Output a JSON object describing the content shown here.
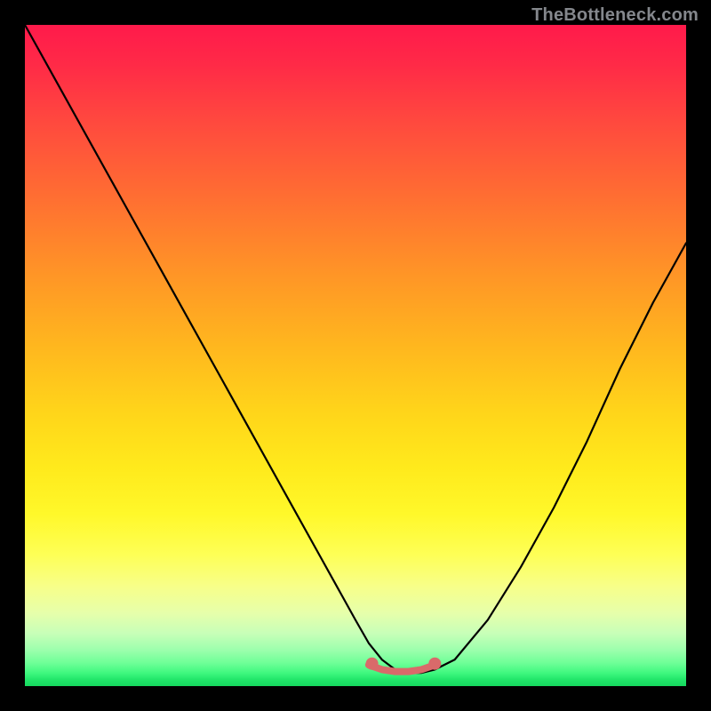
{
  "watermark": "TheBottleneck.com",
  "chart_data": {
    "type": "line",
    "title": "",
    "xlabel": "",
    "ylabel": "",
    "xlim": [
      0,
      100
    ],
    "ylim": [
      0,
      100
    ],
    "grid": false,
    "series": [
      {
        "name": "curve",
        "color": "#000000",
        "x": [
          0,
          5,
          10,
          15,
          20,
          25,
          30,
          35,
          40,
          45,
          50,
          52,
          54,
          56,
          58,
          60,
          62,
          65,
          70,
          75,
          80,
          85,
          90,
          95,
          100
        ],
        "y": [
          100,
          91,
          82,
          73,
          64,
          55,
          46,
          37,
          28,
          19,
          10,
          6.5,
          4,
          2.5,
          2,
          2,
          2.5,
          4,
          10,
          18,
          27,
          37,
          48,
          58,
          67
        ]
      },
      {
        "name": "bottom-segment",
        "color": "#d96a6a",
        "x": [
          52,
          54,
          56,
          58,
          60,
          62
        ],
        "y": [
          3.2,
          2.5,
          2.2,
          2.2,
          2.5,
          3.2
        ]
      }
    ],
    "markers": [
      {
        "name": "dot-left",
        "x": 52.5,
        "y": 3.4,
        "color": "#d96a6a"
      },
      {
        "name": "dot-right",
        "x": 62.0,
        "y": 3.4,
        "color": "#d96a6a"
      }
    ]
  }
}
